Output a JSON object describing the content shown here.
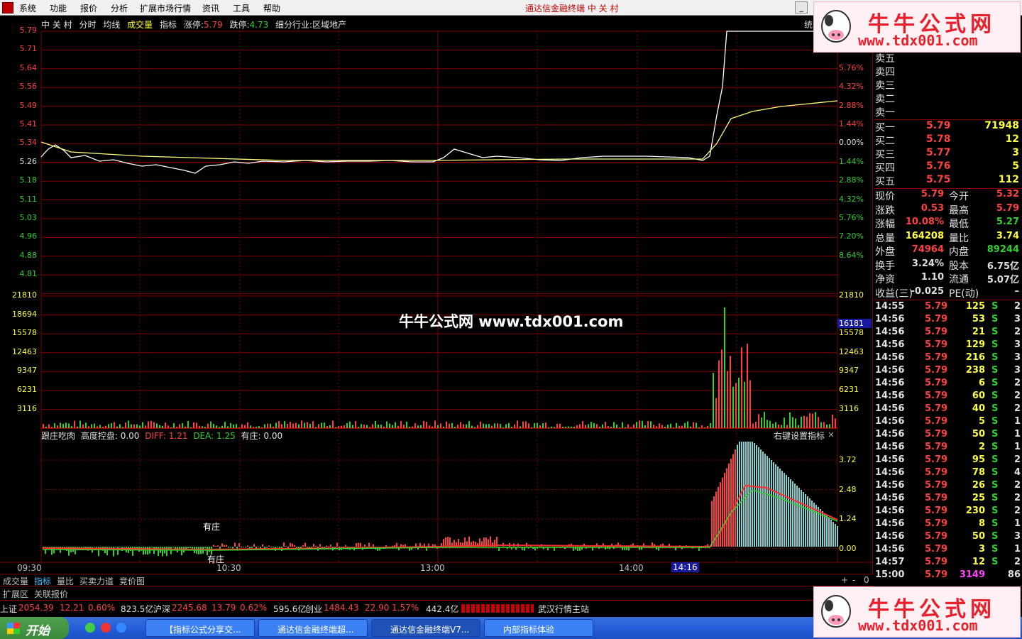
{
  "menu": {
    "items": [
      "系统",
      "功能",
      "报价",
      "分析",
      "扩展市场行情",
      "资讯",
      "工具",
      "帮助"
    ],
    "title": "通达信金融终端  中 关 村"
  },
  "header": {
    "name": "中 关 村",
    "items": [
      "分时",
      "均线",
      "成交量",
      "指标"
    ],
    "limit_up_label": "涨停:",
    "limit_up": "5.79",
    "limit_down_label": "跌停:",
    "limit_down": "4.73",
    "industry": "细分行业:区域地产",
    "right_cut": "统"
  },
  "price_axis": {
    "left": [
      "5.79",
      "5.71",
      "5.64",
      "5.56",
      "5.49",
      "5.41",
      "5.34",
      "5.26",
      "5.18",
      "5.11",
      "5.03",
      "4.96",
      "4.88",
      "4.81"
    ],
    "right": [
      "",
      "7.20%",
      "5.76%",
      "4.32%",
      "2.88%",
      "1.44%",
      "0.00%",
      "1.44%",
      "2.88%",
      "4.32%",
      "5.76%",
      "7.20%",
      "8.64%"
    ]
  },
  "vol_axis": {
    "left": [
      "21810",
      "18694",
      "15578",
      "12463",
      "9347",
      "6231",
      "3116"
    ],
    "right": [
      "21810",
      "18694",
      "15578",
      "12463",
      "9347",
      "6231",
      "3116"
    ],
    "marker": "16181"
  },
  "indicator": {
    "name": "跟庄吃肉",
    "param1": "高度控盘: 0.00",
    "diff": "DIFF: 1.21",
    "dea": "DEA: 1.25",
    "youzhuang": "有庄: 0.00",
    "right_label": "右键设置指标",
    "right_axis": [
      "3.72",
      "2.48",
      "1.24",
      "0.00"
    ],
    "note1": "有庄",
    "note2": "有庄"
  },
  "time_axis": {
    "labels": [
      "09:30",
      "10:30",
      "13:00",
      "14:00"
    ],
    "cursor": "14:16"
  },
  "tabs": {
    "row1": [
      "成交量",
      "指标",
      "量比",
      "买卖力道",
      "竞价图"
    ],
    "row2": [
      "扩展区",
      "关联报价"
    ],
    "ctrl": [
      "+",
      "-",
      "0"
    ]
  },
  "statusbar": {
    "sh_label": "上证",
    "sh": "2054.39",
    "sh_chg": "12.21",
    "sh_pct": "0.60%",
    "sh_amt": "823.5亿",
    "sz_label": "沪深",
    "sz": "2245.68",
    "sz_chg": "13.79",
    "sz_pct": "0.62%",
    "sz_amt": "595.6亿",
    "cy_label": "创业",
    "cy": "1484.43",
    "cy_chg": "22.90",
    "cy_pct": "1.57%",
    "cy_amt": "442.4亿",
    "station": "武汉行情主站"
  },
  "orderbook": {
    "sells": [
      {
        "label": "卖五"
      },
      {
        "label": "卖四"
      },
      {
        "label": "卖三"
      },
      {
        "label": "卖二"
      },
      {
        "label": "卖一"
      }
    ],
    "buys": [
      {
        "label": "买一",
        "price": "5.79",
        "vol": "71948"
      },
      {
        "label": "买二",
        "price": "5.78",
        "vol": "12"
      },
      {
        "label": "买三",
        "price": "5.77",
        "vol": "3"
      },
      {
        "label": "买四",
        "price": "5.76",
        "vol": "5"
      },
      {
        "label": "买五",
        "price": "5.75",
        "vol": "112"
      }
    ]
  },
  "quote": [
    {
      "l1": "现价",
      "v1": "5.79",
      "l2": "今开",
      "v2": "5.32"
    },
    {
      "l1": "涨跌",
      "v1": "0.53",
      "l2": "最高",
      "v2": "5.79"
    },
    {
      "l1": "涨幅",
      "v1": "10.08%",
      "l2": "最低",
      "v2": "5.27"
    },
    {
      "l1": "总量",
      "v1": "164208",
      "l2": "量比",
      "v2": "3.74"
    },
    {
      "l1": "外盘",
      "v1": "74964",
      "l2": "内盘",
      "v2": "89244"
    },
    {
      "l1": "换手",
      "v1": "3.24%",
      "l2": "股本",
      "v2": "6.75亿"
    },
    {
      "l1": "净资",
      "v1": "1.10",
      "l2": "流通",
      "v2": "5.07亿"
    },
    {
      "l1": "收益(三)",
      "v1": "-0.025",
      "l2": "PE(动)",
      "v2": "–"
    }
  ],
  "ticks": [
    {
      "t": "14:55",
      "p": "5.79",
      "v": "125",
      "s": "S",
      "n": "2"
    },
    {
      "t": "14:56",
      "p": "5.79",
      "v": "53",
      "s": "S",
      "n": "3"
    },
    {
      "t": "14:56",
      "p": "5.79",
      "v": "21",
      "s": "S",
      "n": "2"
    },
    {
      "t": "14:56",
      "p": "5.79",
      "v": "129",
      "s": "S",
      "n": "3"
    },
    {
      "t": "14:56",
      "p": "5.79",
      "v": "216",
      "s": "S",
      "n": "3"
    },
    {
      "t": "14:56",
      "p": "5.79",
      "v": "238",
      "s": "S",
      "n": "3"
    },
    {
      "t": "14:56",
      "p": "5.79",
      "v": "6",
      "s": "S",
      "n": "2"
    },
    {
      "t": "14:56",
      "p": "5.79",
      "v": "60",
      "s": "S",
      "n": "2"
    },
    {
      "t": "14:56",
      "p": "5.79",
      "v": "40",
      "s": "S",
      "n": "2"
    },
    {
      "t": "14:56",
      "p": "5.79",
      "v": "5",
      "s": "S",
      "n": "1"
    },
    {
      "t": "14:56",
      "p": "5.79",
      "v": "50",
      "s": "S",
      "n": "1"
    },
    {
      "t": "14:56",
      "p": "5.79",
      "v": "2",
      "s": "S",
      "n": "1"
    },
    {
      "t": "14:56",
      "p": "5.79",
      "v": "95",
      "s": "S",
      "n": "2"
    },
    {
      "t": "14:56",
      "p": "5.79",
      "v": "78",
      "s": "S",
      "n": "4"
    },
    {
      "t": "14:56",
      "p": "5.79",
      "v": "26",
      "s": "S",
      "n": "2"
    },
    {
      "t": "14:56",
      "p": "5.79",
      "v": "25",
      "s": "S",
      "n": "2"
    },
    {
      "t": "14:56",
      "p": "5.79",
      "v": "230",
      "s": "S",
      "n": "2"
    },
    {
      "t": "14:56",
      "p": "5.79",
      "v": "8",
      "s": "S",
      "n": "1"
    },
    {
      "t": "14:56",
      "p": "5.79",
      "v": "50",
      "s": "S",
      "n": "3"
    },
    {
      "t": "14:56",
      "p": "5.79",
      "v": "3",
      "s": "S",
      "n": "1"
    },
    {
      "t": "14:57",
      "p": "5.79",
      "v": "12",
      "s": "S",
      "n": "2"
    },
    {
      "t": "15:00",
      "p": "5.79",
      "v": "3149",
      "s": "",
      "n": "86"
    }
  ],
  "taskbar": {
    "start": "开始",
    "buttons": [
      "【指标公式分享交...",
      "通达信金融终端超...",
      "通达信金融终端V7...",
      "内部指标体验"
    ]
  },
  "watermark": {
    "brand": "牛牛公式网",
    "url": "www.tdx001.com",
    "center": "牛牛公式网 www.tdx001.com"
  },
  "colors": {
    "grid": "#800000",
    "up": "#ff4040",
    "down": "#30d030",
    "price_line": "#ffffff",
    "avg_line": "#ffff80"
  }
}
